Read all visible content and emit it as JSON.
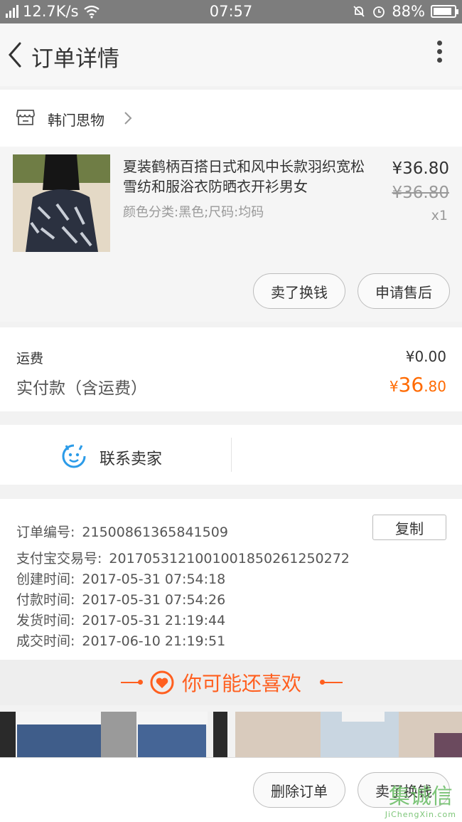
{
  "status_bar": {
    "network": "12.7K/s",
    "time": "07:57",
    "battery": "88%",
    "battery_level": 0.88
  },
  "nav": {
    "title": "订单详情"
  },
  "shop": {
    "name": "韩门思物"
  },
  "product": {
    "name": "夏装鹤柄百搭日式和风中长款羽织宽松雪纺和服浴衣防晒衣开衫男女",
    "sku": "颜色分类:黑色;尺码:均码",
    "price": "¥36.80",
    "original_price": "¥36.80",
    "quantity": "x1",
    "sell_button": "卖了换钱",
    "after_sales_button": "申请售后"
  },
  "fees": {
    "shipping_label": "运费",
    "shipping_value": "¥0.00",
    "paid_label": "实付款（含运费）",
    "paid_symbol": "¥",
    "paid_integer": "36",
    "paid_decimal": ".80"
  },
  "contact": {
    "label": "联系卖家"
  },
  "order_info": {
    "copy_button": "复制",
    "rows": [
      {
        "label": "订单编号:",
        "value": "21500861365841509"
      },
      {
        "label": "支付宝交易号:",
        "value": "2017053121001001850261250272"
      },
      {
        "label": "创建时间:",
        "value": "2017-05-31 07:54:18"
      },
      {
        "label": "付款时间:",
        "value": "2017-05-31 07:54:26"
      },
      {
        "label": "发货时间:",
        "value": "2017-05-31 21:19:44"
      },
      {
        "label": "成交时间:",
        "value": "2017-06-10 21:19:51"
      }
    ]
  },
  "recommend": {
    "title": "你可能还喜欢"
  },
  "bottom_bar": {
    "delete_button": "删除订单",
    "sell_button": "卖了换钱"
  },
  "watermark": {
    "main": "集诚信",
    "sub": "JiChengXin.com"
  },
  "colors": {
    "accent": "#ff6a00",
    "status_bar": "#7d7d7d",
    "background": "#f2f2f2"
  }
}
